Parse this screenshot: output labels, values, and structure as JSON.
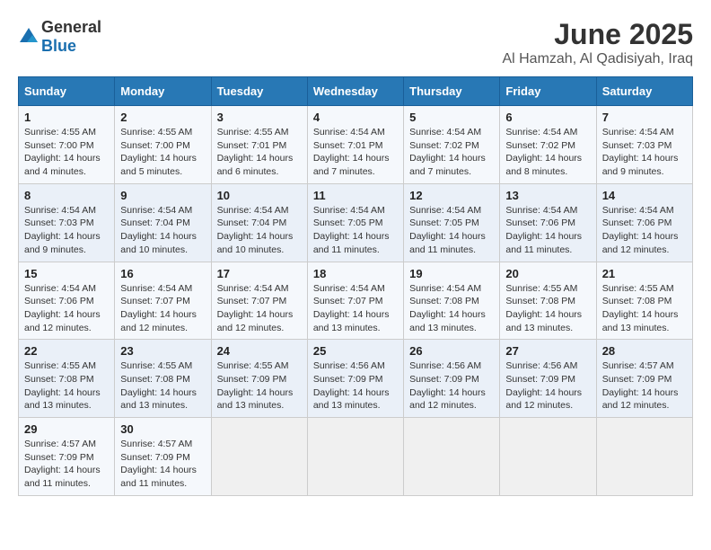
{
  "header": {
    "logo_general": "General",
    "logo_blue": "Blue",
    "title": "June 2025",
    "subtitle": "Al Hamzah, Al Qadisiyah, Iraq"
  },
  "calendar": {
    "days_of_week": [
      "Sunday",
      "Monday",
      "Tuesday",
      "Wednesday",
      "Thursday",
      "Friday",
      "Saturday"
    ],
    "weeks": [
      [
        null,
        {
          "day": "2",
          "sunrise": "4:55 AM",
          "sunset": "7:00 PM",
          "daylight": "14 hours and 5 minutes."
        },
        {
          "day": "3",
          "sunrise": "4:55 AM",
          "sunset": "7:01 PM",
          "daylight": "14 hours and 6 minutes."
        },
        {
          "day": "4",
          "sunrise": "4:54 AM",
          "sunset": "7:01 PM",
          "daylight": "14 hours and 7 minutes."
        },
        {
          "day": "5",
          "sunrise": "4:54 AM",
          "sunset": "7:02 PM",
          "daylight": "14 hours and 7 minutes."
        },
        {
          "day": "6",
          "sunrise": "4:54 AM",
          "sunset": "7:02 PM",
          "daylight": "14 hours and 8 minutes."
        },
        {
          "day": "7",
          "sunrise": "4:54 AM",
          "sunset": "7:03 PM",
          "daylight": "14 hours and 9 minutes."
        }
      ],
      [
        {
          "day": "1",
          "sunrise": "4:55 AM",
          "sunset": "7:00 PM",
          "daylight": "14 hours and 4 minutes."
        },
        {
          "day": "9",
          "sunrise": "4:54 AM",
          "sunset": "7:04 PM",
          "daylight": "14 hours and 10 minutes."
        },
        {
          "day": "10",
          "sunrise": "4:54 AM",
          "sunset": "7:04 PM",
          "daylight": "14 hours and 10 minutes."
        },
        {
          "day": "11",
          "sunrise": "4:54 AM",
          "sunset": "7:05 PM",
          "daylight": "14 hours and 11 minutes."
        },
        {
          "day": "12",
          "sunrise": "4:54 AM",
          "sunset": "7:05 PM",
          "daylight": "14 hours and 11 minutes."
        },
        {
          "day": "13",
          "sunrise": "4:54 AM",
          "sunset": "7:06 PM",
          "daylight": "14 hours and 11 minutes."
        },
        {
          "day": "14",
          "sunrise": "4:54 AM",
          "sunset": "7:06 PM",
          "daylight": "14 hours and 12 minutes."
        }
      ],
      [
        {
          "day": "8",
          "sunrise": "4:54 AM",
          "sunset": "7:03 PM",
          "daylight": "14 hours and 9 minutes."
        },
        {
          "day": "16",
          "sunrise": "4:54 AM",
          "sunset": "7:07 PM",
          "daylight": "14 hours and 12 minutes."
        },
        {
          "day": "17",
          "sunrise": "4:54 AM",
          "sunset": "7:07 PM",
          "daylight": "14 hours and 12 minutes."
        },
        {
          "day": "18",
          "sunrise": "4:54 AM",
          "sunset": "7:07 PM",
          "daylight": "14 hours and 13 minutes."
        },
        {
          "day": "19",
          "sunrise": "4:54 AM",
          "sunset": "7:08 PM",
          "daylight": "14 hours and 13 minutes."
        },
        {
          "day": "20",
          "sunrise": "4:55 AM",
          "sunset": "7:08 PM",
          "daylight": "14 hours and 13 minutes."
        },
        {
          "day": "21",
          "sunrise": "4:55 AM",
          "sunset": "7:08 PM",
          "daylight": "14 hours and 13 minutes."
        }
      ],
      [
        {
          "day": "15",
          "sunrise": "4:54 AM",
          "sunset": "7:06 PM",
          "daylight": "14 hours and 12 minutes."
        },
        {
          "day": "23",
          "sunrise": "4:55 AM",
          "sunset": "7:08 PM",
          "daylight": "14 hours and 13 minutes."
        },
        {
          "day": "24",
          "sunrise": "4:55 AM",
          "sunset": "7:09 PM",
          "daylight": "14 hours and 13 minutes."
        },
        {
          "day": "25",
          "sunrise": "4:56 AM",
          "sunset": "7:09 PM",
          "daylight": "14 hours and 13 minutes."
        },
        {
          "day": "26",
          "sunrise": "4:56 AM",
          "sunset": "7:09 PM",
          "daylight": "14 hours and 12 minutes."
        },
        {
          "day": "27",
          "sunrise": "4:56 AM",
          "sunset": "7:09 PM",
          "daylight": "14 hours and 12 minutes."
        },
        {
          "day": "28",
          "sunrise": "4:57 AM",
          "sunset": "7:09 PM",
          "daylight": "14 hours and 12 minutes."
        }
      ],
      [
        {
          "day": "22",
          "sunrise": "4:55 AM",
          "sunset": "7:08 PM",
          "daylight": "14 hours and 13 minutes."
        },
        {
          "day": "30",
          "sunrise": "4:57 AM",
          "sunset": "7:09 PM",
          "daylight": "14 hours and 11 minutes."
        },
        null,
        null,
        null,
        null,
        null
      ],
      [
        {
          "day": "29",
          "sunrise": "4:57 AM",
          "sunset": "7:09 PM",
          "daylight": "14 hours and 11 minutes."
        },
        null,
        null,
        null,
        null,
        null,
        null
      ]
    ]
  }
}
